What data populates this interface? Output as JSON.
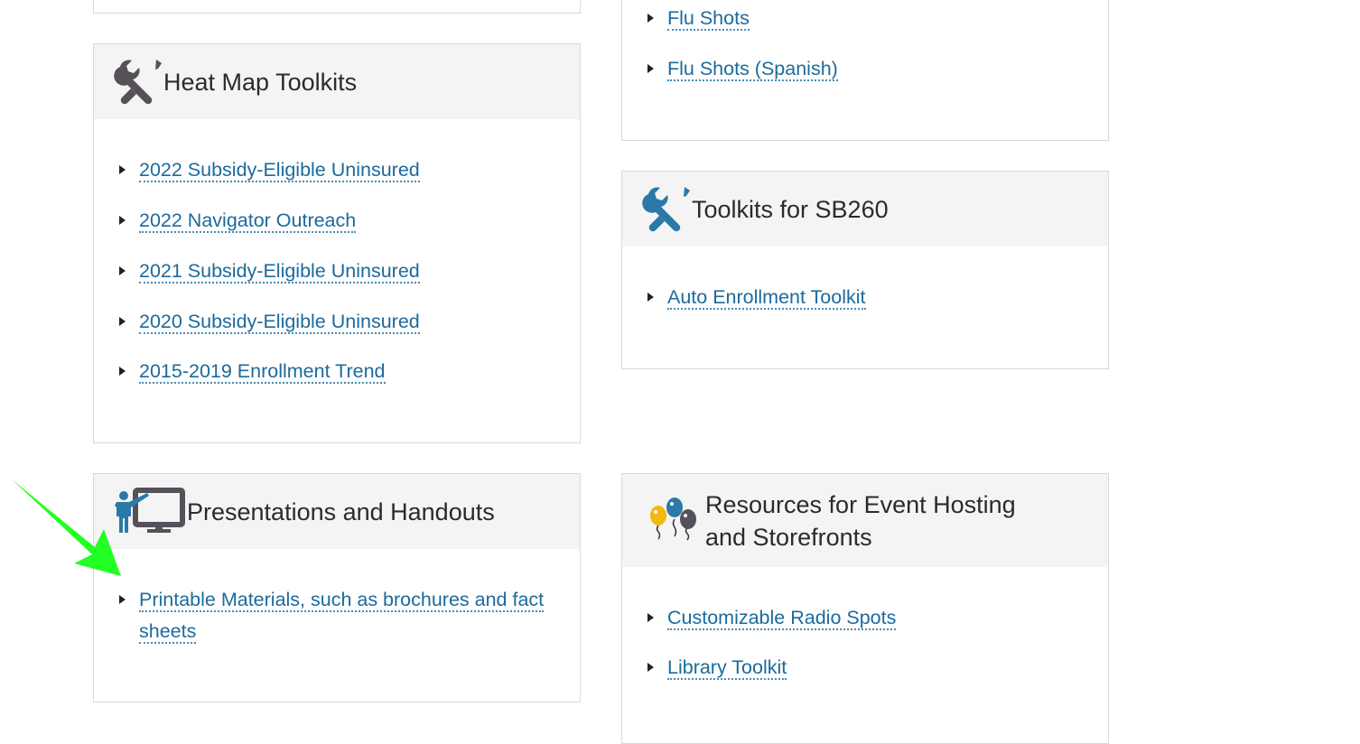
{
  "cards": {
    "top_left": {},
    "flu": {
      "links": [
        "Flu Shots",
        "Flu Shots (Spanish)"
      ]
    },
    "heat_map": {
      "title": "Heat Map Toolkits",
      "icon": "tools-icon",
      "links": [
        "2022 Subsidy-Eligible Uninsured",
        "2022 Navigator Outreach",
        "2021 Subsidy-Eligible Uninsured",
        "2020 Subsidy-Eligible Uninsured",
        "2015-2019 Enrollment Trend"
      ]
    },
    "sb260": {
      "title": "Toolkits for SB260",
      "icon": "tools-icon",
      "links": [
        "Auto Enrollment Toolkit"
      ]
    },
    "presentations": {
      "title": "Presentations and Handouts",
      "icon": "presenter-icon",
      "links": [
        "Printable Materials, such as brochures and fact sheets"
      ]
    },
    "events": {
      "title_line1": "Resources for Event Hosting",
      "title_line2": "and Storefronts",
      "icon": "balloons-icon",
      "links": [
        "Customizable Radio Spots",
        "Library Toolkit"
      ]
    }
  },
  "annotation": {
    "icon": "green-arrow-pointer",
    "color": "#22ff22"
  },
  "colors": {
    "link": "#1c6a9c",
    "header_bg": "#f4f4f4",
    "border": "#d9d9d9",
    "icon_gray": "#565058",
    "icon_blue": "#2a79a8"
  }
}
